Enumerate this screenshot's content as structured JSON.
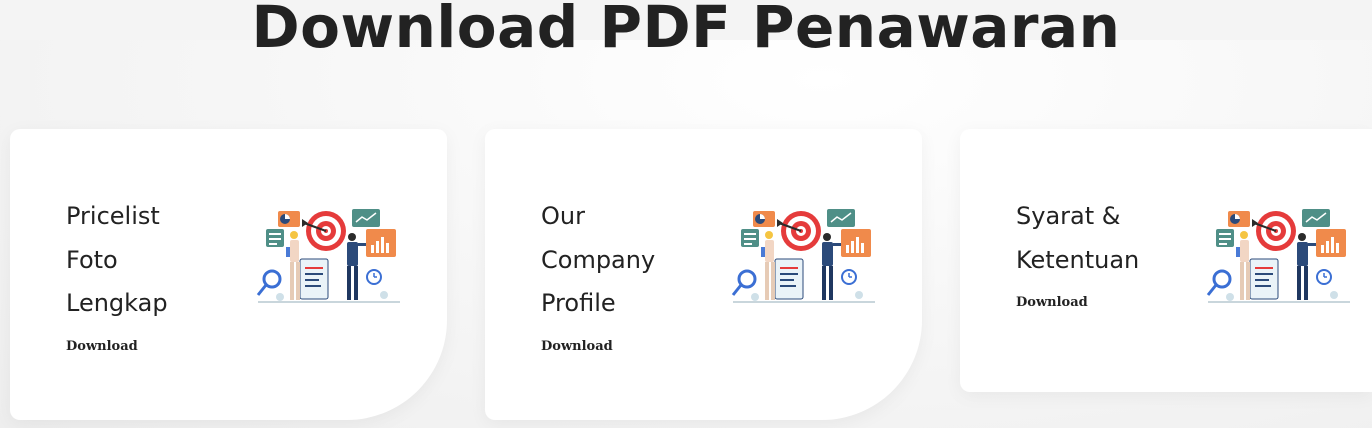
{
  "page": {
    "title": "Download PDF Penawaran"
  },
  "cards": [
    {
      "title_lines": [
        "Pricelist",
        "Foto",
        "Lengkap"
      ],
      "link_label": "Download",
      "illustration_icon": "business-target-illustration"
    },
    {
      "title_lines": [
        "Our",
        "Company",
        "Profile"
      ],
      "link_label": "Download",
      "illustration_icon": "business-target-illustration"
    },
    {
      "title_lines": [
        "Syarat &",
        "Ketentuan"
      ],
      "link_label": "Download",
      "illustration_icon": "business-target-illustration"
    }
  ],
  "colors": {
    "background": "#f4f4f4",
    "card": "#ffffff",
    "text": "#222222",
    "target_red": "#e53b3b",
    "orange": "#f08a4b",
    "teal": "#4f8f87",
    "navy": "#2b4a7a"
  }
}
